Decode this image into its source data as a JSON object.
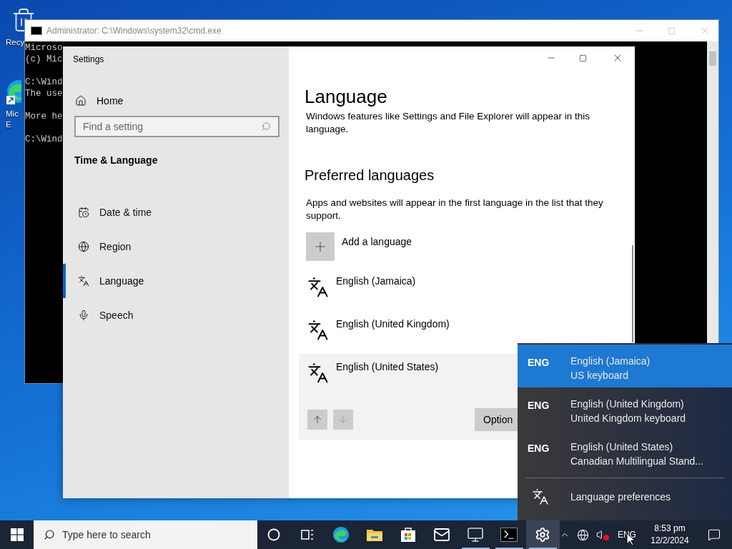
{
  "desktop_icons": [
    {
      "kind": "recycle-bin",
      "lines": [
        "Recy"
      ]
    },
    {
      "kind": "edge-shortcut",
      "lines": [
        "Mic",
        "E"
      ]
    }
  ],
  "cmd_window": {
    "title": "Administrator: C:\\Windows\\system32\\cmd.exe",
    "paragraphs": [
      [
        "Microso",
        "(c) Mic"
      ],
      [
        "C:\\Wind",
        "The use"
      ],
      [
        "More he"
      ],
      [
        "C:\\Wind"
      ]
    ]
  },
  "settings": {
    "title": "Settings",
    "home": "Home",
    "search": {
      "placeholder": "Find a setting"
    },
    "section": "Time & Language",
    "nav": [
      {
        "kind": "date",
        "label": "Date & time",
        "selected": false
      },
      {
        "kind": "region",
        "label": "Region",
        "selected": false
      },
      {
        "kind": "language",
        "label": "Language",
        "selected": true
      },
      {
        "kind": "speech",
        "label": "Speech",
        "selected": false
      }
    ],
    "page": {
      "title": "Language",
      "description": "Windows features like Settings and File Explorer will appear in this language.",
      "preferred_title": "Preferred languages",
      "preferred_description": "Apps and websites will appear in the first language in the list that they support.",
      "add_label": "Add a language",
      "languages": [
        {
          "name": "English (Jamaica)",
          "selected": false
        },
        {
          "name": "English (United Kingdom)",
          "selected": false
        },
        {
          "name": "English (United States)",
          "selected": true
        }
      ],
      "move_up_disabled": false,
      "move_down_disabled": true,
      "options_button": "Option"
    }
  },
  "language_flyout": {
    "items": [
      {
        "code": "ENG",
        "name": "English (Jamaica)",
        "keyboard": "US keyboard",
        "selected": true
      },
      {
        "code": "ENG",
        "name": "English (United Kingdom)",
        "keyboard": "United Kingdom keyboard",
        "selected": false
      },
      {
        "code": "ENG",
        "name": "English (United States)",
        "keyboard": "Canadian Multilingual Stand...",
        "selected": false
      }
    ],
    "preferences": "Language preferences"
  },
  "taskbar": {
    "search_placeholder": "Type here to search",
    "apps": [
      {
        "kind": "cortana",
        "running": false,
        "active": false
      },
      {
        "kind": "task-view",
        "running": false,
        "active": false
      },
      {
        "kind": "edge",
        "running": false,
        "active": false
      },
      {
        "kind": "explorer",
        "running": false,
        "active": false
      },
      {
        "kind": "store",
        "running": false,
        "active": false
      },
      {
        "kind": "mail",
        "running": false,
        "active": false
      },
      {
        "kind": "monitor",
        "running": true,
        "active": false
      },
      {
        "kind": "terminal",
        "running": true,
        "active": false
      },
      {
        "kind": "settings",
        "running": true,
        "active": true
      }
    ],
    "input_indicator": "ENG",
    "time": "8:53 pm",
    "date": "12/2/2024"
  }
}
